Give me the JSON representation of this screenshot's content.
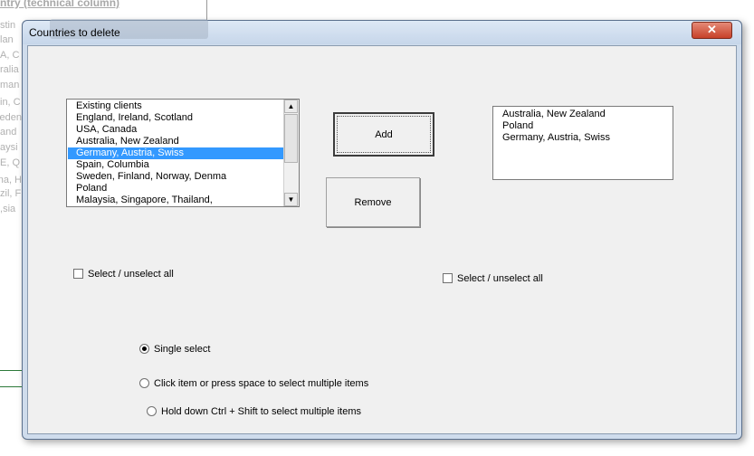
{
  "background": {
    "header": "ntry (technical column)",
    "cells": [
      "stin",
      "lan",
      "A, C",
      "ralia",
      "man",
      "in, C",
      "eden",
      "and",
      "aysi",
      "E, Q",
      "na, H",
      "zil, F",
      "sia,"
    ]
  },
  "window": {
    "title": "Countries to delete",
    "close_label": "✕"
  },
  "left_list": {
    "items": [
      {
        "label": "Existing clients",
        "selected": false
      },
      {
        "label": "England, Ireland, Scotland",
        "selected": false
      },
      {
        "label": "USA, Canada",
        "selected": false
      },
      {
        "label": "Australia, New Zealand",
        "selected": false
      },
      {
        "label": "Germany, Austria, Swiss",
        "selected": true
      },
      {
        "label": "Spain, Columbia",
        "selected": false
      },
      {
        "label": "Sweden, Finland, Norway, Denma",
        "selected": false
      },
      {
        "label": "Poland",
        "selected": false
      },
      {
        "label": "Malaysia, Singapore, Thailand,",
        "selected": false
      }
    ]
  },
  "right_list": {
    "items": [
      {
        "label": "Australia, New Zealand"
      },
      {
        "label": "Poland"
      },
      {
        "label": "Germany, Austria, Swiss"
      }
    ]
  },
  "buttons": {
    "add_label": "Add",
    "remove_label": "Remove"
  },
  "checkboxes": {
    "left_label": "Select / unselect all",
    "left_checked": false,
    "right_label": "Select / unselect all",
    "right_checked": false
  },
  "selection_mode": {
    "options": [
      {
        "label": "Single select",
        "checked": true
      },
      {
        "label": "Click item or press space to select multiple items",
        "checked": false
      },
      {
        "label": "Hold down Ctrl + Shift to select multiple items",
        "checked": false
      }
    ]
  },
  "colors": {
    "selection": "#3399ff",
    "close_button": "#c7412a"
  }
}
